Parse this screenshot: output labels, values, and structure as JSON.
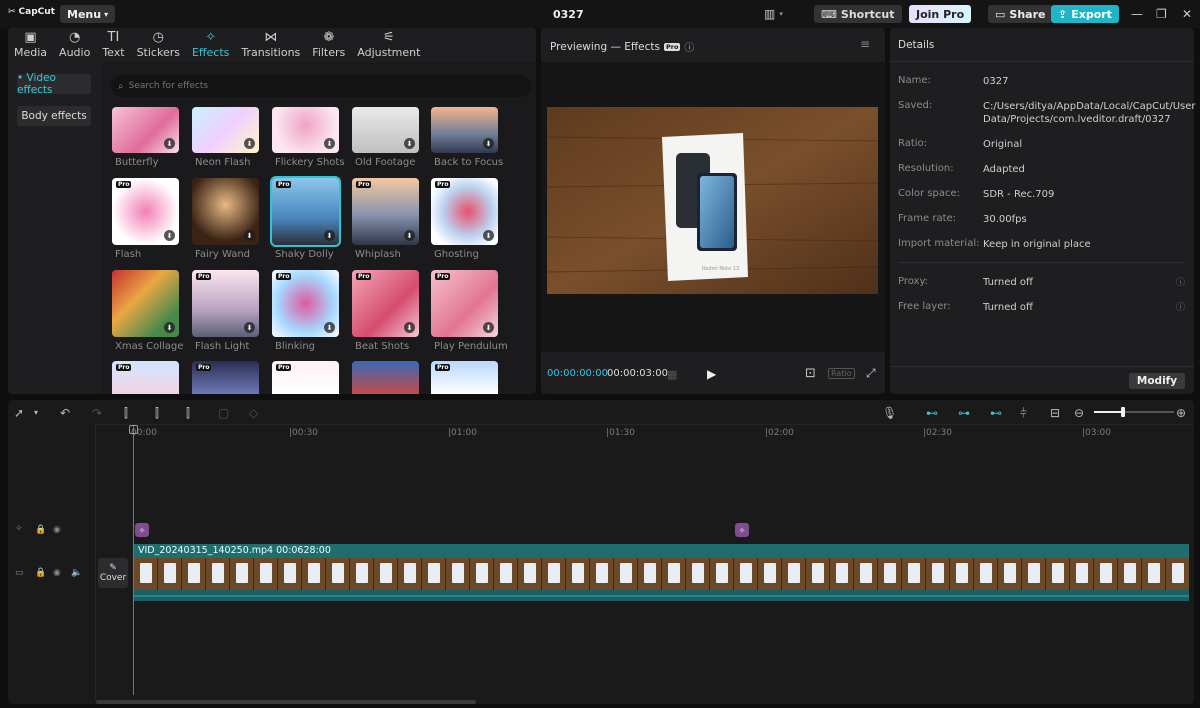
{
  "app": {
    "logo_text": "CapCut",
    "menu_label": "Menu",
    "project_title": "0327"
  },
  "titlebar": {
    "shortcut_label": "Shortcut",
    "joinpro_label": "Join Pro",
    "share_label": "Share",
    "export_label": "Export"
  },
  "tabs": [
    {
      "label": "Media",
      "icon": "media-icon"
    },
    {
      "label": "Audio",
      "icon": "audio-icon"
    },
    {
      "label": "Text",
      "icon": "text-icon"
    },
    {
      "label": "Stickers",
      "icon": "stickers-icon"
    },
    {
      "label": "Effects",
      "icon": "effects-icon"
    },
    {
      "label": "Transitions",
      "icon": "transitions-icon"
    },
    {
      "label": "Filters",
      "icon": "filters-icon"
    },
    {
      "label": "Adjustment",
      "icon": "adjustment-icon"
    }
  ],
  "sidebar": {
    "video_effects": "• Video effects",
    "body_effects": "Body effects"
  },
  "search": {
    "placeholder": "Search for effects"
  },
  "effects": [
    {
      "label": "Butterfly",
      "pro": false
    },
    {
      "label": "Neon Flash",
      "pro": false
    },
    {
      "label": "Flickery Shots",
      "pro": false
    },
    {
      "label": "Old Footage",
      "pro": false
    },
    {
      "label": "Back to Focus",
      "pro": false
    },
    {
      "label": "Flash",
      "pro": true
    },
    {
      "label": "Fairy Wand",
      "pro": false
    },
    {
      "label": "Shaky Dolly",
      "pro": true
    },
    {
      "label": "Whiplash",
      "pro": true
    },
    {
      "label": "Ghosting",
      "pro": true
    },
    {
      "label": "Xmas Collage",
      "pro": false
    },
    {
      "label": "Flash Light",
      "pro": true
    },
    {
      "label": "Blinking",
      "pro": true
    },
    {
      "label": "Beat Shots",
      "pro": true
    },
    {
      "label": "Play Pendulum",
      "pro": true
    }
  ],
  "pro_badge": "Pro",
  "preview": {
    "title": "Previewing — Effects",
    "pro_badge": "Pro",
    "current_time": "00:00:00:00",
    "total_time": "00:00:03:00",
    "ratio_label": "Ratio",
    "box_text": "Redmi Note 13"
  },
  "details": {
    "header": "Details",
    "rows": [
      {
        "label": "Name:",
        "value": "0327"
      },
      {
        "label": "Saved:",
        "value": "C:/Users/ditya/AppData/Local/CapCut/User Data/Projects/com.lveditor.draft/0327"
      },
      {
        "label": "Ratio:",
        "value": "Original"
      },
      {
        "label": "Resolution:",
        "value": "Adapted"
      },
      {
        "label": "Color space:",
        "value": "SDR - Rec.709"
      },
      {
        "label": "Frame rate:",
        "value": "30.00fps"
      },
      {
        "label": "Import material:",
        "value": "Keep in original place"
      },
      {
        "label": "Proxy:",
        "value": "Turned off"
      },
      {
        "label": "Free layer:",
        "value": "Turned off"
      }
    ],
    "modify_label": "Modify"
  },
  "timeline": {
    "ruler": [
      "00:00",
      "|00:30",
      "|01:00",
      "|01:30",
      "|02:00",
      "|02:30",
      "|03:00"
    ],
    "clip_name": "VID_20240315_140250.mp4   00:0628:00",
    "cover_label": "Cover"
  }
}
